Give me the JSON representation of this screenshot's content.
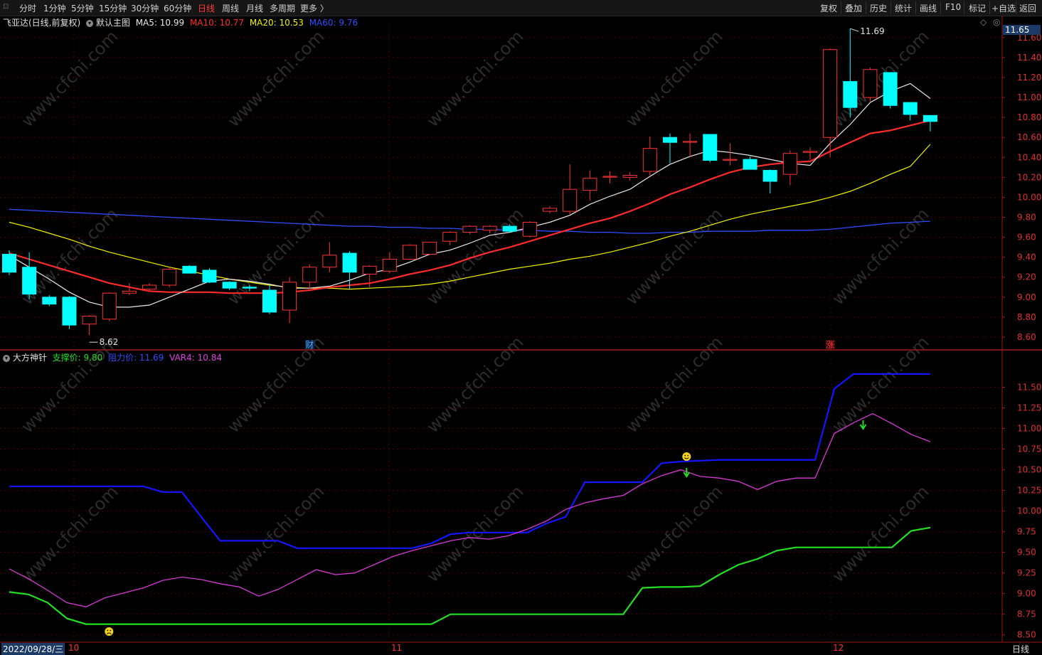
{
  "toolbar": {
    "periods": [
      "分时",
      "1分钟",
      "5分钟",
      "15分钟",
      "30分钟",
      "60分钟",
      "日线",
      "周线",
      "月线",
      "多周期",
      "更多 〉"
    ],
    "active_period": "日线",
    "tools": [
      "复权",
      "叠加",
      "历史",
      "统计",
      "画线",
      "F10",
      "标记",
      "+自选",
      "返回"
    ]
  },
  "main_panel": {
    "stock_name": "飞亚达(日线,前复权)",
    "template": "默认主图",
    "ma": [
      {
        "label": "MA5: 10.99",
        "color": "#e8e8e8"
      },
      {
        "label": "MA10: 10.77",
        "color": "#ff2b2b"
      },
      {
        "label": "MA20: 10.53",
        "color": "#f2f200"
      },
      {
        "label": "MA60: 9.76",
        "color": "#2f4cff"
      }
    ],
    "current_price_tag": "11.65",
    "high_annotation": "11.69",
    "low_annotation": "8.62",
    "markers": [
      {
        "text": "财",
        "color": "#4da6ff"
      },
      {
        "text": "涨",
        "color": "#ff3030"
      }
    ],
    "y_ticks": [
      "11.60",
      "11.40",
      "11.20",
      "11.00",
      "10.80",
      "10.60",
      "10.40",
      "10.20",
      "10.00",
      "9.80",
      "9.60",
      "9.40",
      "9.20",
      "9.00",
      "8.80",
      "8.60"
    ]
  },
  "sub_panel": {
    "indicator_name": "大方神针",
    "labels": [
      {
        "label": "支撑价: 9.80",
        "color": "#22e022"
      },
      {
        "label": "阻力价: 11.69",
        "color": "#2f4cff"
      },
      {
        "label": "VAR4: 10.84",
        "color": "#e040e0"
      }
    ],
    "y_ticks": [
      "11.50",
      "11.25",
      "11.00",
      "10.75",
      "10.50",
      "10.25",
      "10.00",
      "9.75",
      "9.50",
      "9.25",
      "9.00",
      "8.75",
      "8.50"
    ]
  },
  "bottom": {
    "date": "2022/09/28/三",
    "months": [
      "10",
      "11",
      "12"
    ],
    "period_label": "日线"
  },
  "watermark": "www.cfchi.com",
  "colors": {
    "up": "#ff3232",
    "down": "#00ffff",
    "grid": "#5a0000",
    "axis": "#ff3232"
  },
  "chart_data": {
    "type": "candlestick",
    "ylim": [
      8.5,
      11.72
    ],
    "candles": [
      {
        "o": 9.43,
        "h": 9.47,
        "l": 9.22,
        "c": 9.25
      },
      {
        "o": 9.3,
        "h": 9.45,
        "l": 8.98,
        "c": 9.03
      },
      {
        "o": 9.0,
        "h": 9.02,
        "l": 8.91,
        "c": 8.93
      },
      {
        "o": 9.0,
        "h": 9.01,
        "l": 8.68,
        "c": 8.72
      },
      {
        "o": 8.73,
        "h": 8.82,
        "l": 8.62,
        "c": 8.81
      },
      {
        "o": 8.78,
        "h": 9.05,
        "l": 8.76,
        "c": 9.04
      },
      {
        "o": 9.04,
        "h": 9.14,
        "l": 9.02,
        "c": 9.06
      },
      {
        "o": 9.08,
        "h": 9.14,
        "l": 9.06,
        "c": 9.12
      },
      {
        "o": 9.12,
        "h": 9.3,
        "l": 9.1,
        "c": 9.28
      },
      {
        "o": 9.31,
        "h": 9.32,
        "l": 9.24,
        "c": 9.24
      },
      {
        "o": 9.27,
        "h": 9.29,
        "l": 9.14,
        "c": 9.15
      },
      {
        "o": 9.15,
        "h": 9.16,
        "l": 9.07,
        "c": 9.09
      },
      {
        "o": 9.1,
        "h": 9.12,
        "l": 9.06,
        "c": 9.09
      },
      {
        "o": 9.07,
        "h": 9.12,
        "l": 8.83,
        "c": 8.85
      },
      {
        "o": 8.87,
        "h": 9.2,
        "l": 8.74,
        "c": 9.15
      },
      {
        "o": 9.15,
        "h": 9.33,
        "l": 9.08,
        "c": 9.3
      },
      {
        "o": 9.3,
        "h": 9.55,
        "l": 9.25,
        "c": 9.42
      },
      {
        "o": 9.44,
        "h": 9.46,
        "l": 9.08,
        "c": 9.25
      },
      {
        "o": 9.23,
        "h": 9.32,
        "l": 9.1,
        "c": 9.31
      },
      {
        "o": 9.26,
        "h": 9.45,
        "l": 9.24,
        "c": 9.38
      },
      {
        "o": 9.38,
        "h": 9.53,
        "l": 9.37,
        "c": 9.52
      },
      {
        "o": 9.43,
        "h": 9.55,
        "l": 9.42,
        "c": 9.55
      },
      {
        "o": 9.56,
        "h": 9.66,
        "l": 9.52,
        "c": 9.65
      },
      {
        "o": 9.65,
        "h": 9.72,
        "l": 9.63,
        "c": 9.71
      },
      {
        "o": 9.67,
        "h": 9.72,
        "l": 9.64,
        "c": 9.71
      },
      {
        "o": 9.71,
        "h": 9.73,
        "l": 9.65,
        "c": 9.66
      },
      {
        "o": 9.61,
        "h": 9.76,
        "l": 9.6,
        "c": 9.75
      },
      {
        "o": 9.86,
        "h": 9.91,
        "l": 9.84,
        "c": 9.89
      },
      {
        "o": 9.86,
        "h": 10.33,
        "l": 9.83,
        "c": 10.08
      },
      {
        "o": 10.07,
        "h": 10.27,
        "l": 9.97,
        "c": 10.19
      },
      {
        "o": 10.21,
        "h": 10.26,
        "l": 10.14,
        "c": 10.21
      },
      {
        "o": 10.2,
        "h": 10.25,
        "l": 10.17,
        "c": 10.22
      },
      {
        "o": 10.26,
        "h": 10.61,
        "l": 10.22,
        "c": 10.49
      },
      {
        "o": 10.6,
        "h": 10.64,
        "l": 10.34,
        "c": 10.55
      },
      {
        "o": 10.56,
        "h": 10.64,
        "l": 10.41,
        "c": 10.56
      },
      {
        "o": 10.63,
        "h": 10.63,
        "l": 10.35,
        "c": 10.37
      },
      {
        "o": 10.38,
        "h": 10.54,
        "l": 10.32,
        "c": 10.38
      },
      {
        "o": 10.38,
        "h": 10.41,
        "l": 10.28,
        "c": 10.28
      },
      {
        "o": 10.27,
        "h": 10.28,
        "l": 10.04,
        "c": 10.16
      },
      {
        "o": 10.23,
        "h": 10.47,
        "l": 10.12,
        "c": 10.44
      },
      {
        "o": 10.45,
        "h": 10.5,
        "l": 10.38,
        "c": 10.46
      },
      {
        "o": 10.6,
        "h": 11.49,
        "l": 10.4,
        "c": 11.48
      },
      {
        "o": 11.16,
        "h": 11.69,
        "l": 10.8,
        "c": 10.9
      },
      {
        "o": 11.0,
        "h": 11.3,
        "l": 10.96,
        "c": 11.28
      },
      {
        "o": 11.25,
        "h": 11.25,
        "l": 10.89,
        "c": 10.92
      },
      {
        "o": 10.95,
        "h": 10.95,
        "l": 10.77,
        "c": 10.83
      },
      {
        "o": 10.82,
        "h": 10.82,
        "l": 10.66,
        "c": 10.76
      }
    ],
    "ma5": [
      9.42,
      9.3,
      9.18,
      9.05,
      8.95,
      8.9,
      8.9,
      8.92,
      9.0,
      9.08,
      9.16,
      9.18,
      9.16,
      9.13,
      9.09,
      9.09,
      9.11,
      9.17,
      9.24,
      9.28,
      9.35,
      9.43,
      9.47,
      9.54,
      9.62,
      9.65,
      9.7,
      9.75,
      9.82,
      9.93,
      10.01,
      10.08,
      10.21,
      10.33,
      10.41,
      10.47,
      10.45,
      10.42,
      10.38,
      10.34,
      10.32,
      10.54,
      10.73,
      10.95,
      11.06,
      11.14,
      10.99
    ],
    "ma10": [
      9.44,
      9.38,
      9.32,
      9.26,
      9.2,
      9.14,
      9.1,
      9.06,
      9.05,
      9.05,
      9.05,
      9.04,
      9.04,
      9.04,
      9.05,
      9.07,
      9.1,
      9.12,
      9.14,
      9.18,
      9.23,
      9.27,
      9.32,
      9.39,
      9.45,
      9.5,
      9.56,
      9.62,
      9.68,
      9.74,
      9.79,
      9.86,
      9.94,
      10.03,
      10.1,
      10.18,
      10.25,
      10.3,
      10.33,
      10.35,
      10.36,
      10.46,
      10.55,
      10.64,
      10.67,
      10.72,
      10.77
    ],
    "ma20": [
      9.75,
      9.7,
      9.64,
      9.58,
      9.51,
      9.45,
      9.4,
      9.35,
      9.3,
      9.26,
      9.22,
      9.18,
      9.15,
      9.12,
      9.1,
      9.09,
      9.09,
      9.08,
      9.09,
      9.1,
      9.11,
      9.13,
      9.16,
      9.2,
      9.24,
      9.28,
      9.31,
      9.34,
      9.38,
      9.41,
      9.45,
      9.5,
      9.55,
      9.61,
      9.66,
      9.72,
      9.78,
      9.83,
      9.87,
      9.91,
      9.95,
      10.0,
      10.06,
      10.14,
      10.23,
      10.31,
      10.53
    ],
    "ma60": [
      9.88,
      9.87,
      9.86,
      9.85,
      9.84,
      9.83,
      9.82,
      9.81,
      9.8,
      9.79,
      9.78,
      9.77,
      9.76,
      9.75,
      9.74,
      9.73,
      9.72,
      9.71,
      9.71,
      9.7,
      9.7,
      9.69,
      9.69,
      9.68,
      9.68,
      9.67,
      9.67,
      9.66,
      9.66,
      9.65,
      9.65,
      9.64,
      9.64,
      9.65,
      9.65,
      9.66,
      9.66,
      9.66,
      9.67,
      9.67,
      9.67,
      9.68,
      9.7,
      9.72,
      9.74,
      9.75,
      9.76
    ]
  },
  "sub_chart_data": {
    "type": "line",
    "ylim": [
      8.42,
      11.78
    ],
    "resistance": [
      10.3,
      10.3,
      10.3,
      10.3,
      10.3,
      10.3,
      10.3,
      10.3,
      10.23,
      10.23,
      9.93,
      9.64,
      9.64,
      9.64,
      9.64,
      9.55,
      9.55,
      9.55,
      9.55,
      9.55,
      9.55,
      9.55,
      9.61,
      9.72,
      9.74,
      9.74,
      9.74,
      9.74,
      9.85,
      9.93,
      10.35,
      10.35,
      10.35,
      10.35,
      10.58,
      10.6,
      10.61,
      10.62,
      10.62,
      10.62,
      10.62,
      10.62,
      10.62,
      11.48,
      11.66,
      11.66,
      11.66,
      11.66,
      11.66
    ],
    "support": [
      9.02,
      8.99,
      8.89,
      8.7,
      8.63,
      8.63,
      8.63,
      8.63,
      8.63,
      8.63,
      8.63,
      8.63,
      8.63,
      8.63,
      8.63,
      8.63,
      8.63,
      8.63,
      8.63,
      8.63,
      8.63,
      8.63,
      8.63,
      8.75,
      8.75,
      8.75,
      8.75,
      8.75,
      8.75,
      8.75,
      8.75,
      8.75,
      8.75,
      9.07,
      9.08,
      9.08,
      9.09,
      9.23,
      9.35,
      9.42,
      9.52,
      9.56,
      9.56,
      9.56,
      9.56,
      9.56,
      9.56,
      9.76,
      9.8
    ],
    "var4": [
      9.3,
      9.18,
      9.04,
      8.89,
      8.84,
      8.95,
      9.01,
      9.07,
      9.16,
      9.2,
      9.17,
      9.12,
      9.08,
      8.97,
      9.05,
      9.17,
      9.29,
      9.23,
      9.25,
      9.35,
      9.45,
      9.52,
      9.58,
      9.64,
      9.68,
      9.66,
      9.7,
      9.78,
      9.88,
      10.02,
      10.1,
      10.15,
      10.19,
      10.33,
      10.43,
      10.5,
      10.42,
      10.4,
      10.36,
      10.26,
      10.36,
      10.4,
      10.4,
      10.94,
      11.07,
      11.18,
      11.06,
      10.93,
      10.84
    ]
  }
}
